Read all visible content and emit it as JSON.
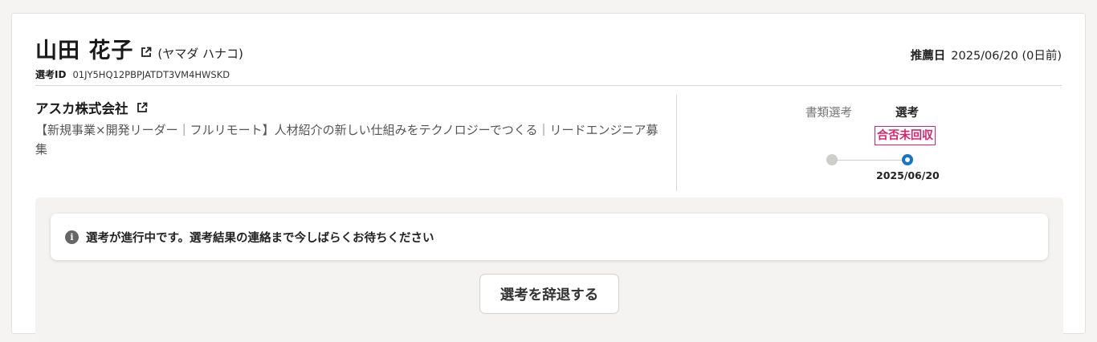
{
  "candidate": {
    "name": "山田 花子",
    "kana": "(ヤマダ ハナコ)",
    "selection_id_label": "選考ID",
    "selection_id": "01JY5HQ12PBPJATDT3VM4HWSKD"
  },
  "recommendation": {
    "label": "推薦日",
    "value": "2025/06/20 (0日前)"
  },
  "company": {
    "name": "アスカ株式会社",
    "job_title": "【新規事業×開発リーダー｜フルリモート】人材紹介の新しい仕組みをテクノロジーでつくる｜リードエンジニア募集"
  },
  "progress": {
    "steps": [
      {
        "label": "書類選考",
        "state": "done"
      },
      {
        "label": "選考",
        "state": "current",
        "status": "合否未回収",
        "date": "2025/06/20"
      }
    ]
  },
  "notice": {
    "icon": "info-icon",
    "text": "選考が進行中です。選考結果の連絡まで今しばらくお待ちください"
  },
  "actions": {
    "withdraw_label": "選考を辞退する"
  },
  "colors": {
    "accent_blue": "#1673c8",
    "status_pink": "#d6246e"
  }
}
